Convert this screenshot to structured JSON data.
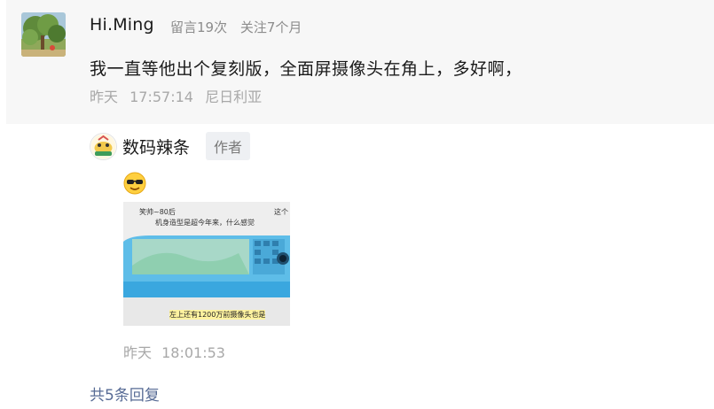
{
  "comment": {
    "username": "Hi.Ming",
    "comment_count_label": "留言19次",
    "follow_duration_label": "关注7个月",
    "text": "我一直等他出个复刻版，全面屏摄像头在角上，多好啊，",
    "time_day": "昨天",
    "time_clock": "17:57:14",
    "location": "尼日利亚"
  },
  "reply": {
    "author_name": "数码辣条",
    "author_badge": "作者",
    "emoji": "sunglasses-emoji",
    "video_caption_top_left": "笑帅~80后",
    "video_caption_top_right": "这个",
    "video_caption_mid": "机身造型是超今年来，什么感觉",
    "video_caption_bottom": "左上还有1200万前摄像头也是",
    "time_day": "昨天",
    "time_clock": "18:01:53"
  },
  "replies_link": "共5条回复",
  "colors": {
    "link": "#576b95",
    "muted": "#a8a8a8",
    "panel_bg": "#f7f7f7",
    "phone_blue": "#5ebde8"
  }
}
